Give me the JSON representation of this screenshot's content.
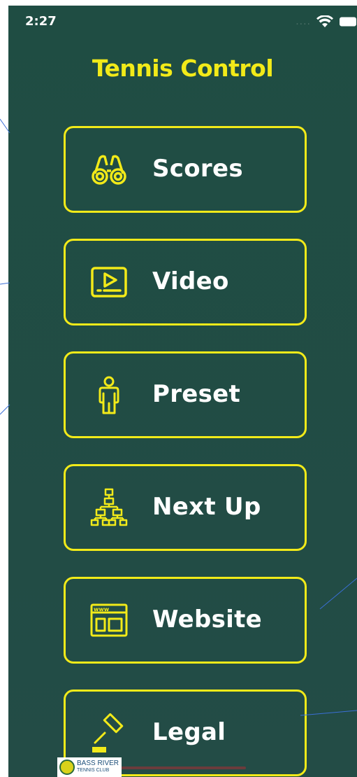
{
  "status_bar": {
    "time": "2:27",
    "signal": "....",
    "icons": [
      "wifi-icon",
      "battery-icon"
    ]
  },
  "header": {
    "title": "Tennis Control"
  },
  "menu": {
    "items": [
      {
        "label": "Scores",
        "icon": "binoculars-icon"
      },
      {
        "label": "Video",
        "icon": "video-player-icon"
      },
      {
        "label": "Preset",
        "icon": "person-icon"
      },
      {
        "label": "Next Up",
        "icon": "bracket-tree-icon"
      },
      {
        "label": "Website",
        "icon": "browser-window-icon"
      },
      {
        "label": "Legal",
        "icon": "gavel-icon"
      }
    ]
  },
  "footer": {
    "logo_line1": "BASS RIVER",
    "logo_line2": "TENNIS CLUB"
  },
  "colors": {
    "background": "#1f4d43",
    "accent": "#f2ea19",
    "label": "#ffffff"
  }
}
